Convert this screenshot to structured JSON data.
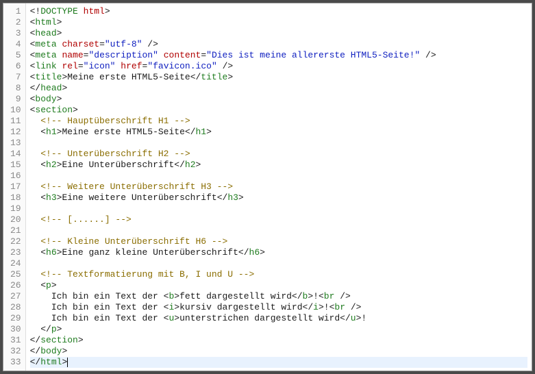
{
  "line_count": 33,
  "cursor_line": 33,
  "lines": [
    {
      "indent": 0,
      "type": "decl",
      "tokens": [
        {
          "c": "t-punc",
          "t": "<!"
        },
        {
          "c": "t-tag",
          "t": "DOCTYPE"
        },
        {
          "c": "t-text",
          "t": " "
        },
        {
          "c": "t-attr",
          "t": "html"
        },
        {
          "c": "t-punc",
          "t": ">"
        }
      ]
    },
    {
      "indent": 0,
      "type": "open",
      "tag": "html"
    },
    {
      "indent": 0,
      "type": "open",
      "tag": "head"
    },
    {
      "indent": 0,
      "type": "selfclose",
      "tag": "meta",
      "attrs": [
        [
          "charset",
          "utf-8"
        ]
      ]
    },
    {
      "indent": 0,
      "type": "selfclose",
      "tag": "meta",
      "attrs": [
        [
          "name",
          "description"
        ],
        [
          "content",
          "Dies ist meine allererste HTML5-Seite!"
        ]
      ]
    },
    {
      "indent": 0,
      "type": "selfclose",
      "tag": "link",
      "attrs": [
        [
          "rel",
          "icon"
        ],
        [
          "href",
          "favicon.ico"
        ]
      ]
    },
    {
      "indent": 0,
      "type": "wrap",
      "tag": "title",
      "text": "Meine erste HTML5-Seite"
    },
    {
      "indent": 0,
      "type": "close",
      "tag": "head"
    },
    {
      "indent": 0,
      "type": "open",
      "tag": "body"
    },
    {
      "indent": 0,
      "type": "open",
      "tag": "section"
    },
    {
      "indent": 1,
      "type": "comment",
      "text": " Hauptüberschrift H1 "
    },
    {
      "indent": 1,
      "type": "wrap",
      "tag": "h1",
      "text": "Meine erste HTML5-Seite"
    },
    {
      "indent": 0,
      "type": "blank"
    },
    {
      "indent": 1,
      "type": "comment",
      "text": " Unterüberschrift H2 "
    },
    {
      "indent": 1,
      "type": "wrap",
      "tag": "h2",
      "text": "Eine Unterüberschrift"
    },
    {
      "indent": 0,
      "type": "blank"
    },
    {
      "indent": 1,
      "type": "comment",
      "text": " Weitere Unterüberschrift H3 "
    },
    {
      "indent": 1,
      "type": "wrap",
      "tag": "h3",
      "text": "Eine weitere Unterüberschrift"
    },
    {
      "indent": 0,
      "type": "blank"
    },
    {
      "indent": 1,
      "type": "comment",
      "text": " [......] "
    },
    {
      "indent": 0,
      "type": "blank"
    },
    {
      "indent": 1,
      "type": "comment",
      "text": " Kleine Unterüberschrift H6 "
    },
    {
      "indent": 1,
      "type": "wrap",
      "tag": "h6",
      "text": "Eine ganz kleine Unterüberschrift"
    },
    {
      "indent": 0,
      "type": "blank"
    },
    {
      "indent": 1,
      "type": "comment",
      "text": " Textformatierung mit B, I und U "
    },
    {
      "indent": 1,
      "type": "open",
      "tag": "p"
    },
    {
      "indent": 2,
      "type": "mixed",
      "pre": "Ich bin ein Text der ",
      "tag": "b",
      "inner": "fett dargestellt wird",
      "post": "!",
      "br": true
    },
    {
      "indent": 2,
      "type": "mixed",
      "pre": "Ich bin ein Text der ",
      "tag": "i",
      "inner": "kursiv dargestellt wird",
      "post": "!",
      "br": true
    },
    {
      "indent": 2,
      "type": "mixed",
      "pre": "Ich bin ein Text der ",
      "tag": "u",
      "inner": "unterstrichen dargestellt wird",
      "post": "!",
      "br": false
    },
    {
      "indent": 1,
      "type": "close",
      "tag": "p"
    },
    {
      "indent": 0,
      "type": "close",
      "tag": "section"
    },
    {
      "indent": 0,
      "type": "close",
      "tag": "body"
    },
    {
      "indent": 0,
      "type": "close",
      "tag": "html",
      "cursor": true
    }
  ]
}
